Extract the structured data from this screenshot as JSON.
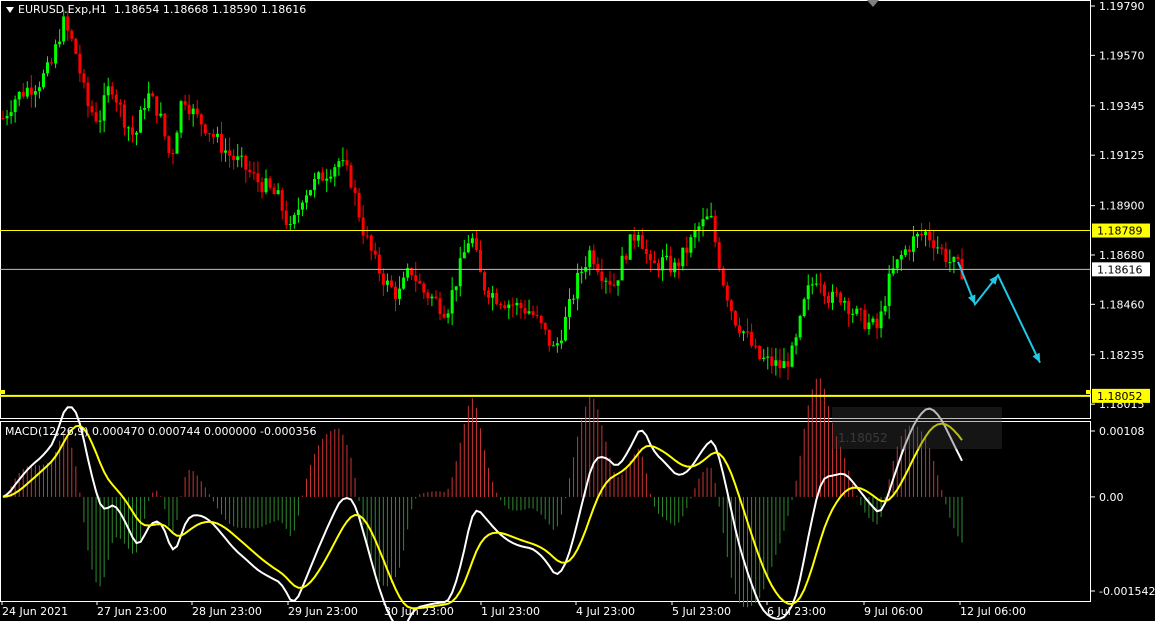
{
  "header": {
    "symbol": "EURUSD.Exp,H1",
    "ohlc": "1.18654 1.18668 1.18590 1.18616"
  },
  "price_axis": {
    "labels": [
      "1.19790",
      "1.19570",
      "1.19345",
      "1.19125",
      "1.18900",
      "1.18680",
      "1.18460",
      "1.18235",
      "1.18015"
    ],
    "min": 1.1798,
    "max": 1.1979
  },
  "levels": {
    "resistance": "1.18789",
    "current": "1.18616",
    "support": "1.18052",
    "resistance_color": "#ffff00",
    "current_color": "#c0c0c0",
    "support_color": "#ffff00"
  },
  "time_axis": {
    "labels": [
      "24 Jun 2021",
      "27 Jun 23:00",
      "28 Jun 23:00",
      "29 Jun 23:00",
      "30 Jun 23:00",
      "1 Jul 23:00",
      "4 Jul 23:00",
      "5 Jul 23:00",
      "6 Jul 23:00",
      "9 Jul 06:00",
      "12 Jul 06:00"
    ]
  },
  "macd": {
    "title": "MACD(12,26,9) 0.000470 0.000744 0.000000 -0.000356",
    "axis_labels": [
      "0.00108",
      "0.00",
      "-0.001542"
    ],
    "max": 0.00108,
    "min": -0.001542
  },
  "ghost_label": "1.18052",
  "colors": {
    "background": "#000000",
    "bull_candle": "#00ff00",
    "bear_candle": "#ff0000",
    "macd_line": "#ffffff",
    "signal_line": "#ffff00",
    "hist_pos": "#cc3333",
    "hist_neg": "#2e8b2e",
    "forecast_arrow": "#1ec8e6",
    "grid": "#ffffff"
  },
  "chart_data": {
    "type": "line",
    "title": "EURUSD.Exp,H1",
    "forecast_path": [
      {
        "x": "12 Jul",
        "y": 1.1865
      },
      {
        "x": "12 Jul",
        "y": 1.1846
      },
      {
        "x": "12 Jul",
        "y": 1.1859
      },
      {
        "x": "13 Jul",
        "y": 1.182
      }
    ],
    "price_path": [
      [
        1.1929,
        1.1938,
        1.1942,
        1.1945,
        1.1952,
        1.1972,
        1.196,
        1.1935,
        1.1928,
        1.1945,
        1.193,
        1.192,
        1.194,
        1.1932,
        1.191,
        1.194,
        1.193,
        1.1925,
        1.1918,
        1.1912,
        1.1908,
        1.1902,
        1.1898,
        1.1893,
        1.1878,
        1.1895,
        1.19,
        1.1905,
        1.191,
        1.1902,
        1.188,
        1.1865,
        1.1855,
        1.185,
        1.1862,
        1.1852,
        1.1848,
        1.1843,
        1.186,
        1.1878,
        1.1855,
        1.185,
        1.1847,
        1.1845,
        1.1843,
        1.1835,
        1.1825,
        1.184,
        1.1858,
        1.187,
        1.186,
        1.1855,
        1.187,
        1.188,
        1.1862,
        1.1865,
        1.1862,
        1.187,
        1.188,
        1.1885,
        1.1858,
        1.184,
        1.1832,
        1.1822,
        1.182,
        1.1818,
        1.1825,
        1.185,
        1.186,
        1.1848,
        1.185,
        1.1842,
        1.1838,
        1.1835,
        1.1858,
        1.1868,
        1.1875,
        1.1878,
        1.1872,
        1.1865,
        1.1861
      ]
    ]
  }
}
